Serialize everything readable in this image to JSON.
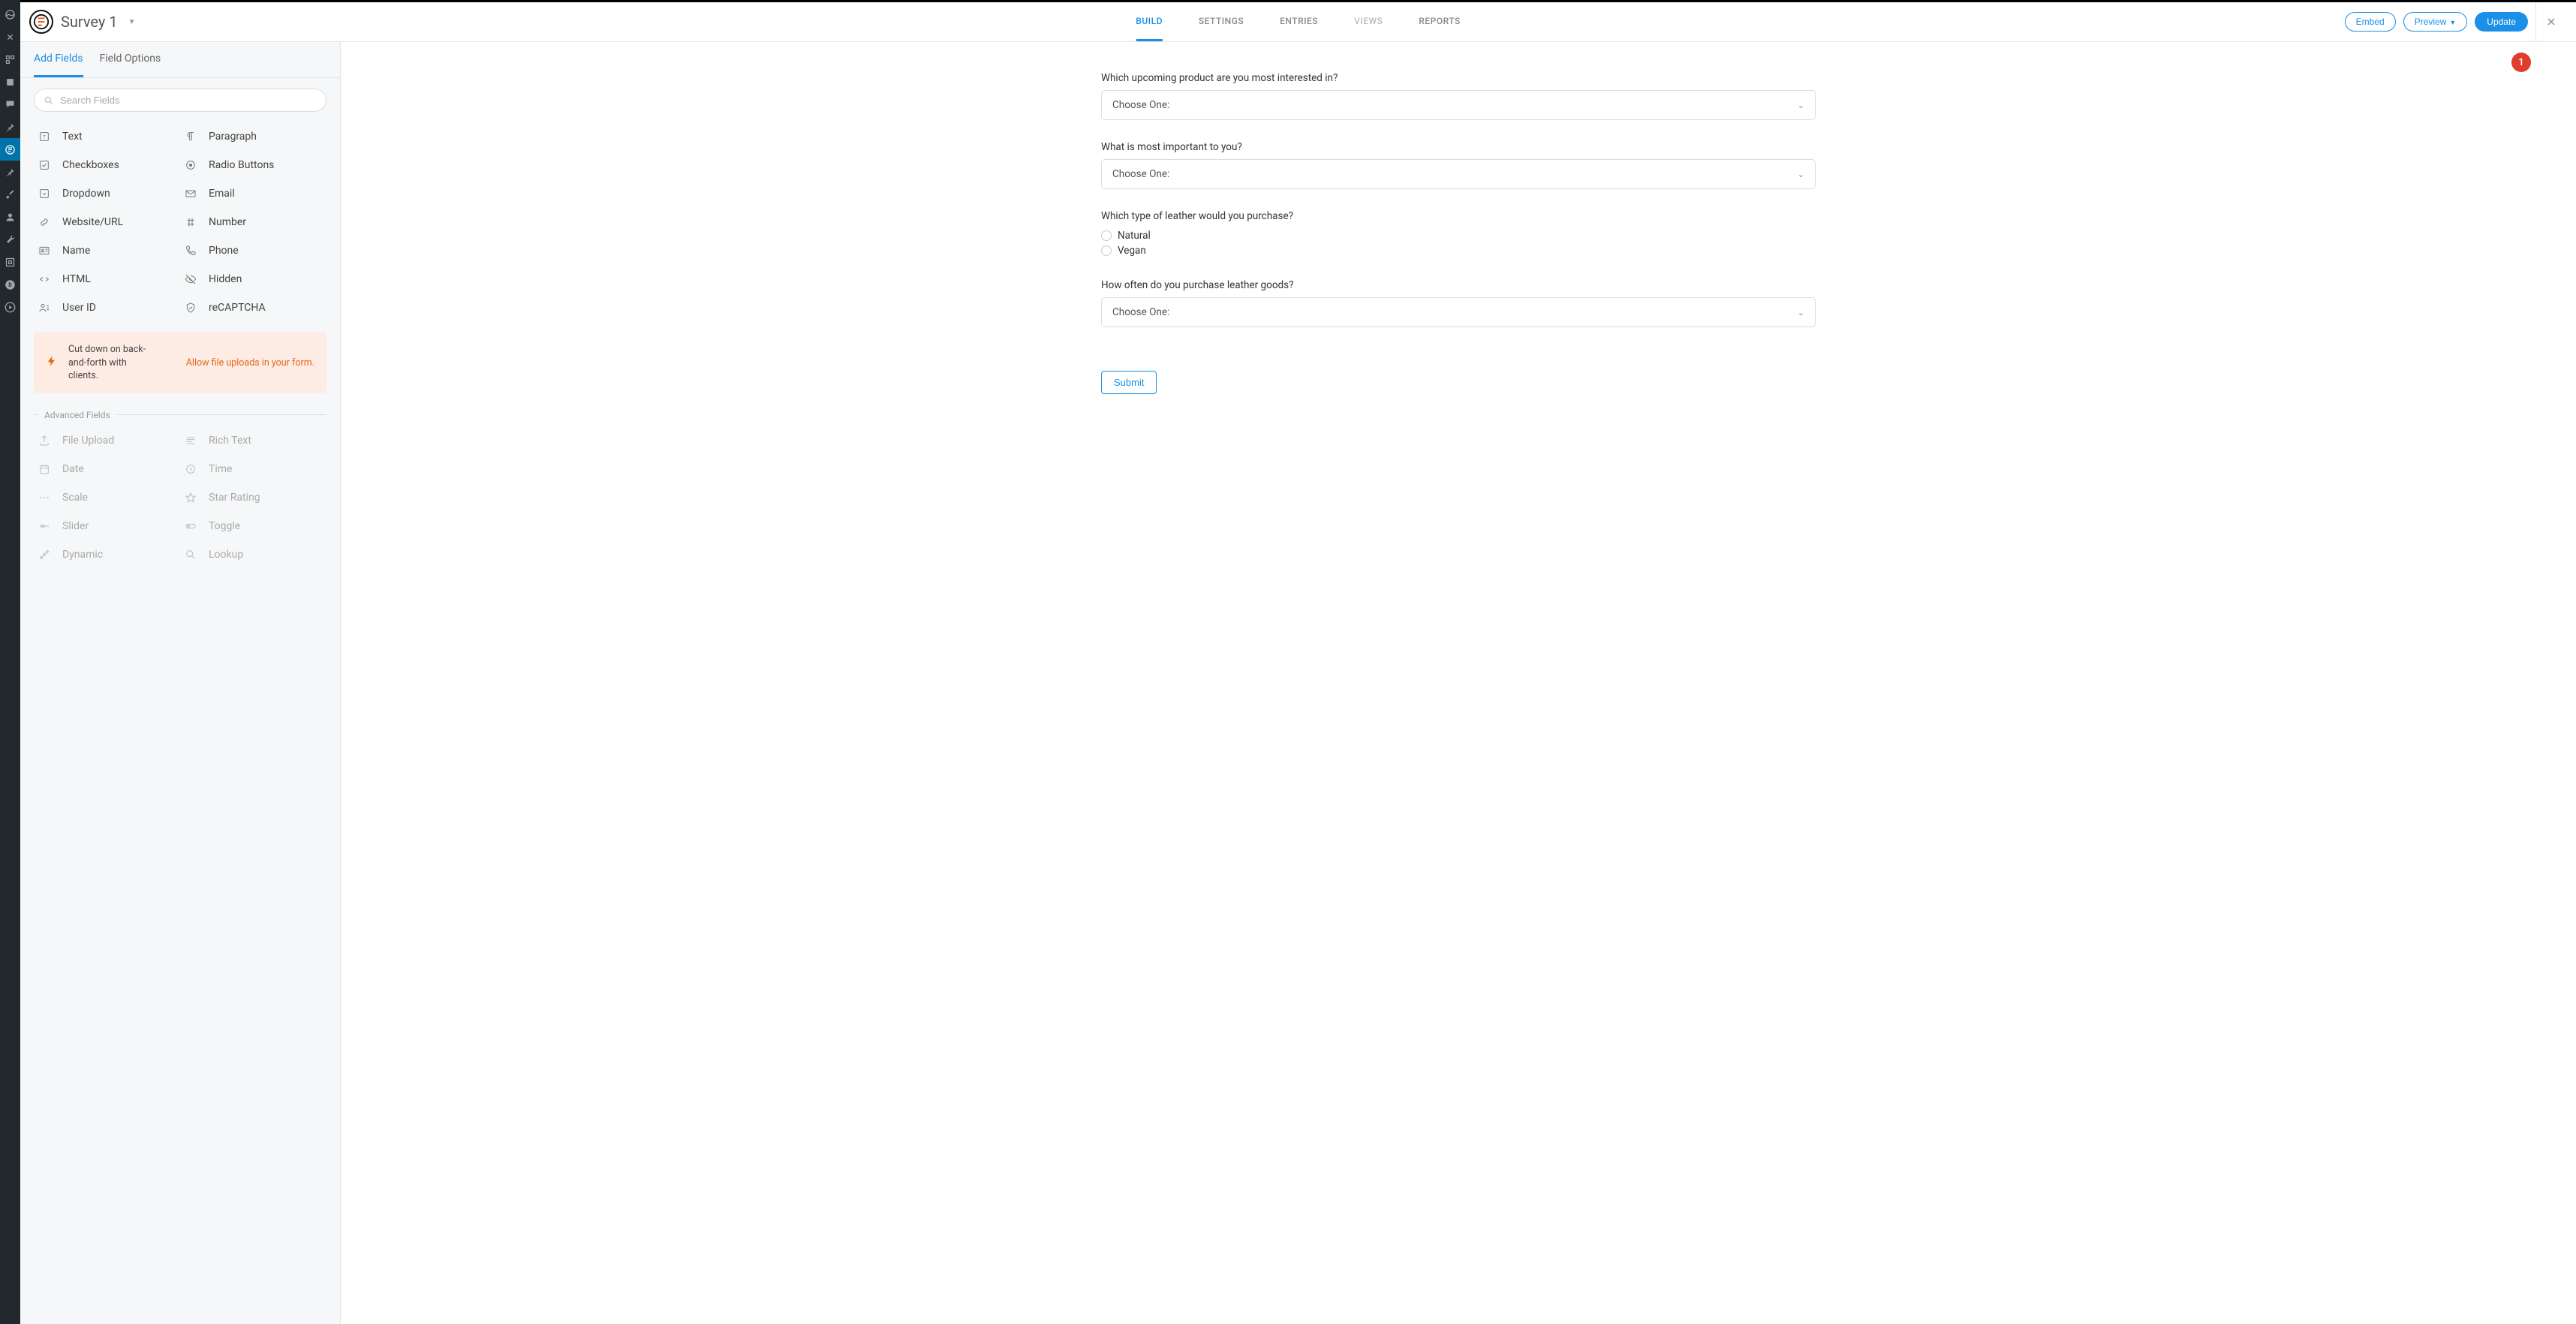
{
  "header": {
    "survey_title": "Survey 1",
    "tabs": [
      "BUILD",
      "SETTINGS",
      "ENTRIES",
      "VIEWS",
      "REPORTS"
    ],
    "active_tab": 0,
    "disabled_tabs": [
      3
    ],
    "embed_label": "Embed",
    "preview_label": "Preview",
    "update_label": "Update",
    "badge_count": "1"
  },
  "sidebar": {
    "tabs": {
      "add_fields": "Add Fields",
      "field_options": "Field Options"
    },
    "search_placeholder": "Search Fields",
    "standard_fields": [
      {
        "label": "Text",
        "icon": "text"
      },
      {
        "label": "Paragraph",
        "icon": "paragraph"
      },
      {
        "label": "Checkboxes",
        "icon": "checkbox"
      },
      {
        "label": "Radio Buttons",
        "icon": "radio"
      },
      {
        "label": "Dropdown",
        "icon": "dropdown"
      },
      {
        "label": "Email",
        "icon": "email"
      },
      {
        "label": "Website/URL",
        "icon": "link"
      },
      {
        "label": "Number",
        "icon": "number"
      },
      {
        "label": "Name",
        "icon": "name"
      },
      {
        "label": "Phone",
        "icon": "phone"
      },
      {
        "label": "HTML",
        "icon": "html"
      },
      {
        "label": "Hidden",
        "icon": "hidden"
      },
      {
        "label": "User ID",
        "icon": "user"
      },
      {
        "label": "reCAPTCHA",
        "icon": "shield"
      }
    ],
    "promo_text": "Cut down on back-and-forth with clients.",
    "promo_link": "Allow file uploads in your form.",
    "advanced_label": "Advanced Fields",
    "advanced_fields": [
      {
        "label": "File Upload",
        "icon": "upload"
      },
      {
        "label": "Rich Text",
        "icon": "richtext"
      },
      {
        "label": "Date",
        "icon": "date"
      },
      {
        "label": "Time",
        "icon": "time"
      },
      {
        "label": "Scale",
        "icon": "scale"
      },
      {
        "label": "Star Rating",
        "icon": "star"
      },
      {
        "label": "Slider",
        "icon": "slider"
      },
      {
        "label": "Toggle",
        "icon": "toggle"
      },
      {
        "label": "Dynamic",
        "icon": "dynamic"
      },
      {
        "label": "Lookup",
        "icon": "lookup"
      }
    ]
  },
  "form": {
    "q1": {
      "label": "Which upcoming product are you most interested in?",
      "placeholder": "Choose One:"
    },
    "q2": {
      "label": "What is most important to you?",
      "placeholder": "Choose One:"
    },
    "q3": {
      "label": "Which type of leather would you purchase?",
      "opt1": "Natural",
      "opt2": "Vegan"
    },
    "q4": {
      "label": "How often do you purchase leather goods?",
      "placeholder": "Choose One:"
    },
    "submit": "Submit"
  }
}
